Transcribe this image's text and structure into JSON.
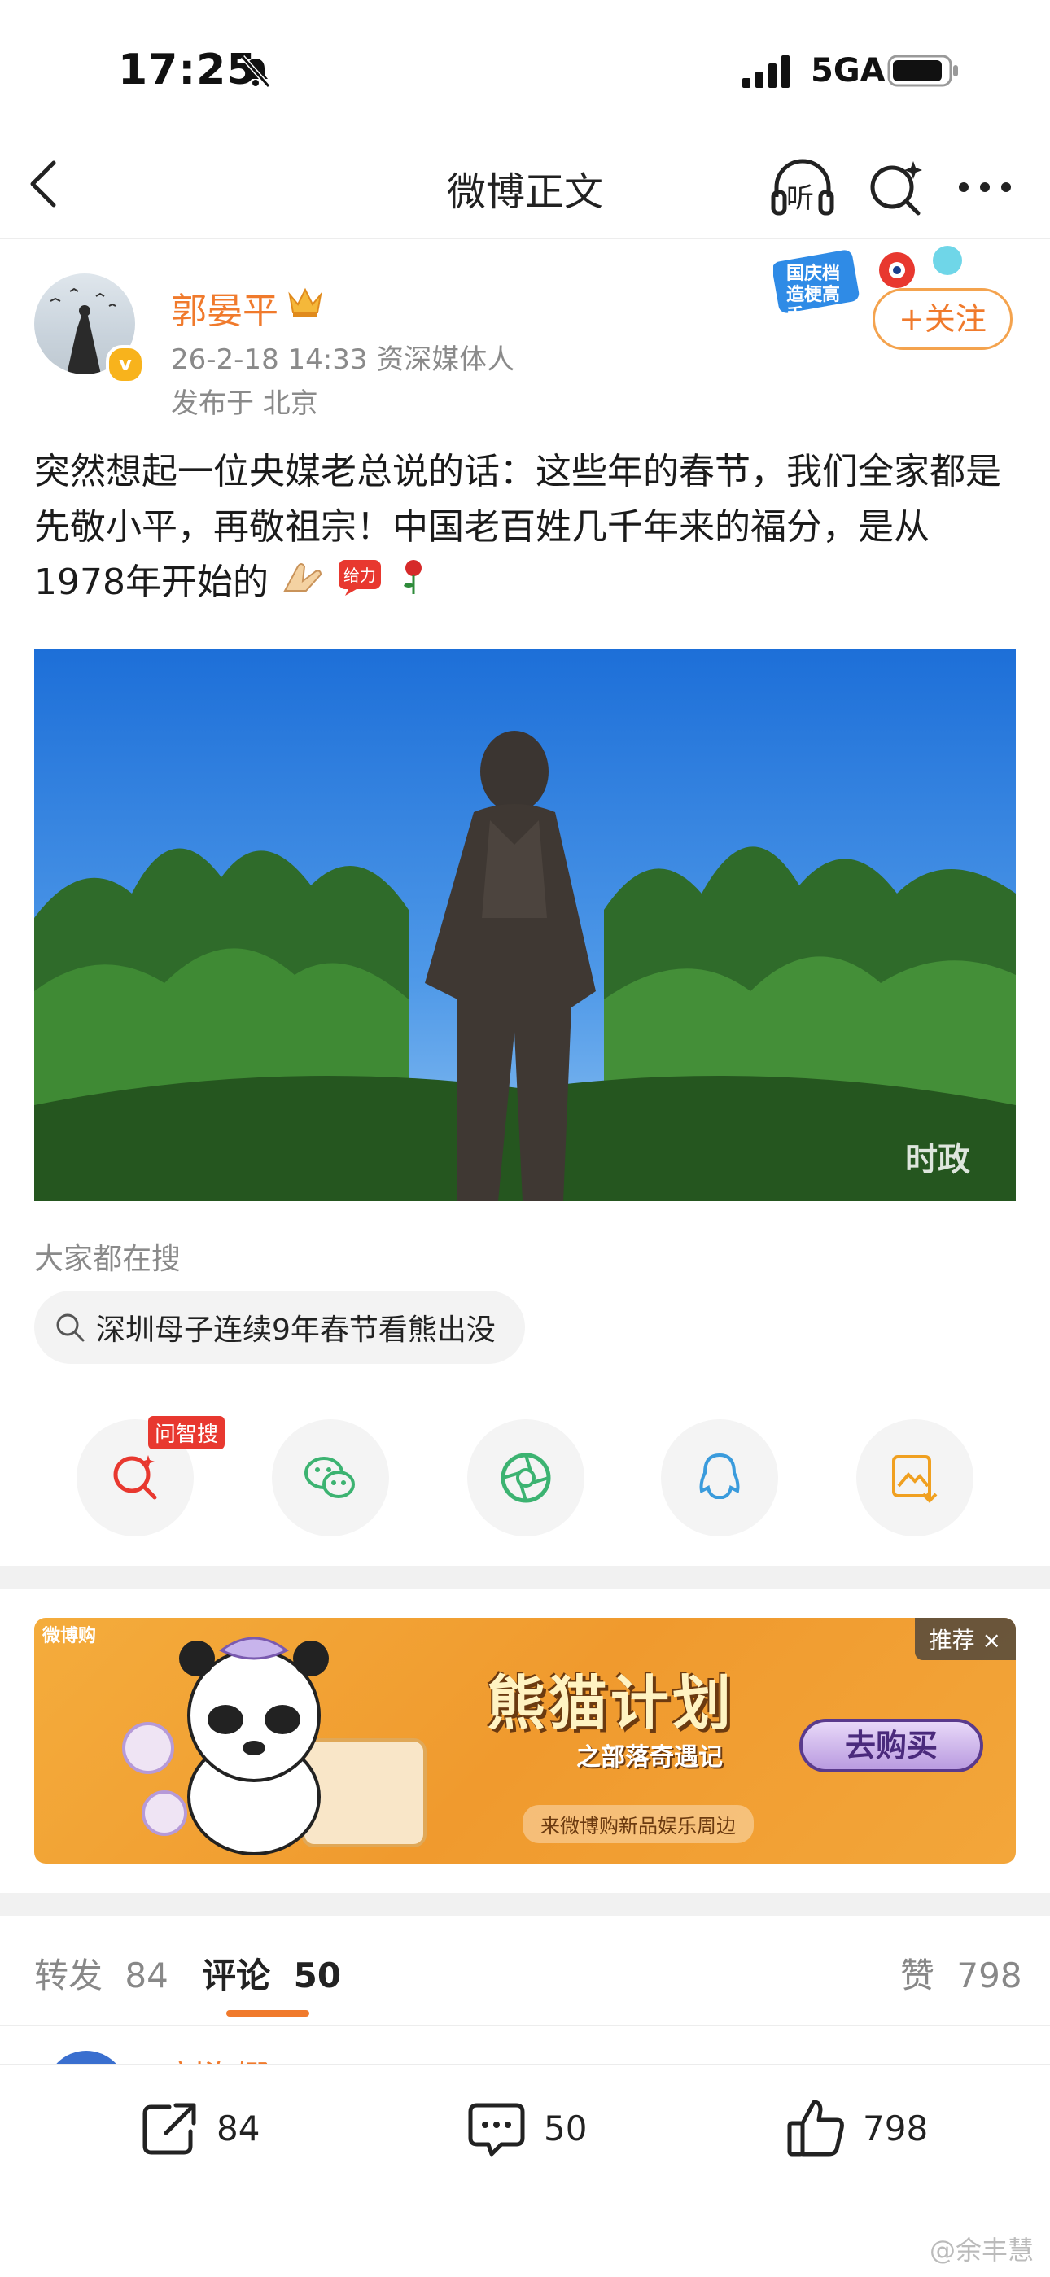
{
  "status_bar": {
    "time": "17:25",
    "network": "5GA"
  },
  "nav": {
    "title": "微博正文",
    "listen_label": "听"
  },
  "author": {
    "name": "郭晏平",
    "meta": "26-2-18 14:33  资深媒体人",
    "location": "发布于 北京",
    "follow_label": "+关注",
    "promo_text": "国庆档 造梗高手",
    "verified_badge": "v"
  },
  "post": {
    "text": "突然想起一位央媒老总说的话：这些年的春节，我们全家都是先敬小平，再敬祖宗！中国老百姓几千年来的福分，是从1978年开始的",
    "emoji_sticker": "给力",
    "image_watermark": "时政"
  },
  "trending": {
    "label": "大家都在搜",
    "query": "深圳母子连续9年春节看熊出没"
  },
  "share": {
    "ai_tag": "问智搜"
  },
  "ad": {
    "brand": "微博购",
    "tag": "推荐 ×",
    "title": "熊猫计划",
    "subtitle": "之部落奇遇记",
    "footer": "来微博购新品娱乐周边",
    "button": "去购买"
  },
  "tabs": {
    "repost_label": "转发",
    "repost_count": "84",
    "comment_label": "评论",
    "comment_count": "50",
    "like_label": "赞",
    "like_count": "798"
  },
  "peek": {
    "name": "刘海娜"
  },
  "bottom_bar": {
    "repost": "84",
    "comment": "50",
    "like": "798"
  },
  "watermark": "@余丰慧",
  "colors": {
    "accent": "#f07a2c",
    "ad_bg": "#f3a63a"
  }
}
